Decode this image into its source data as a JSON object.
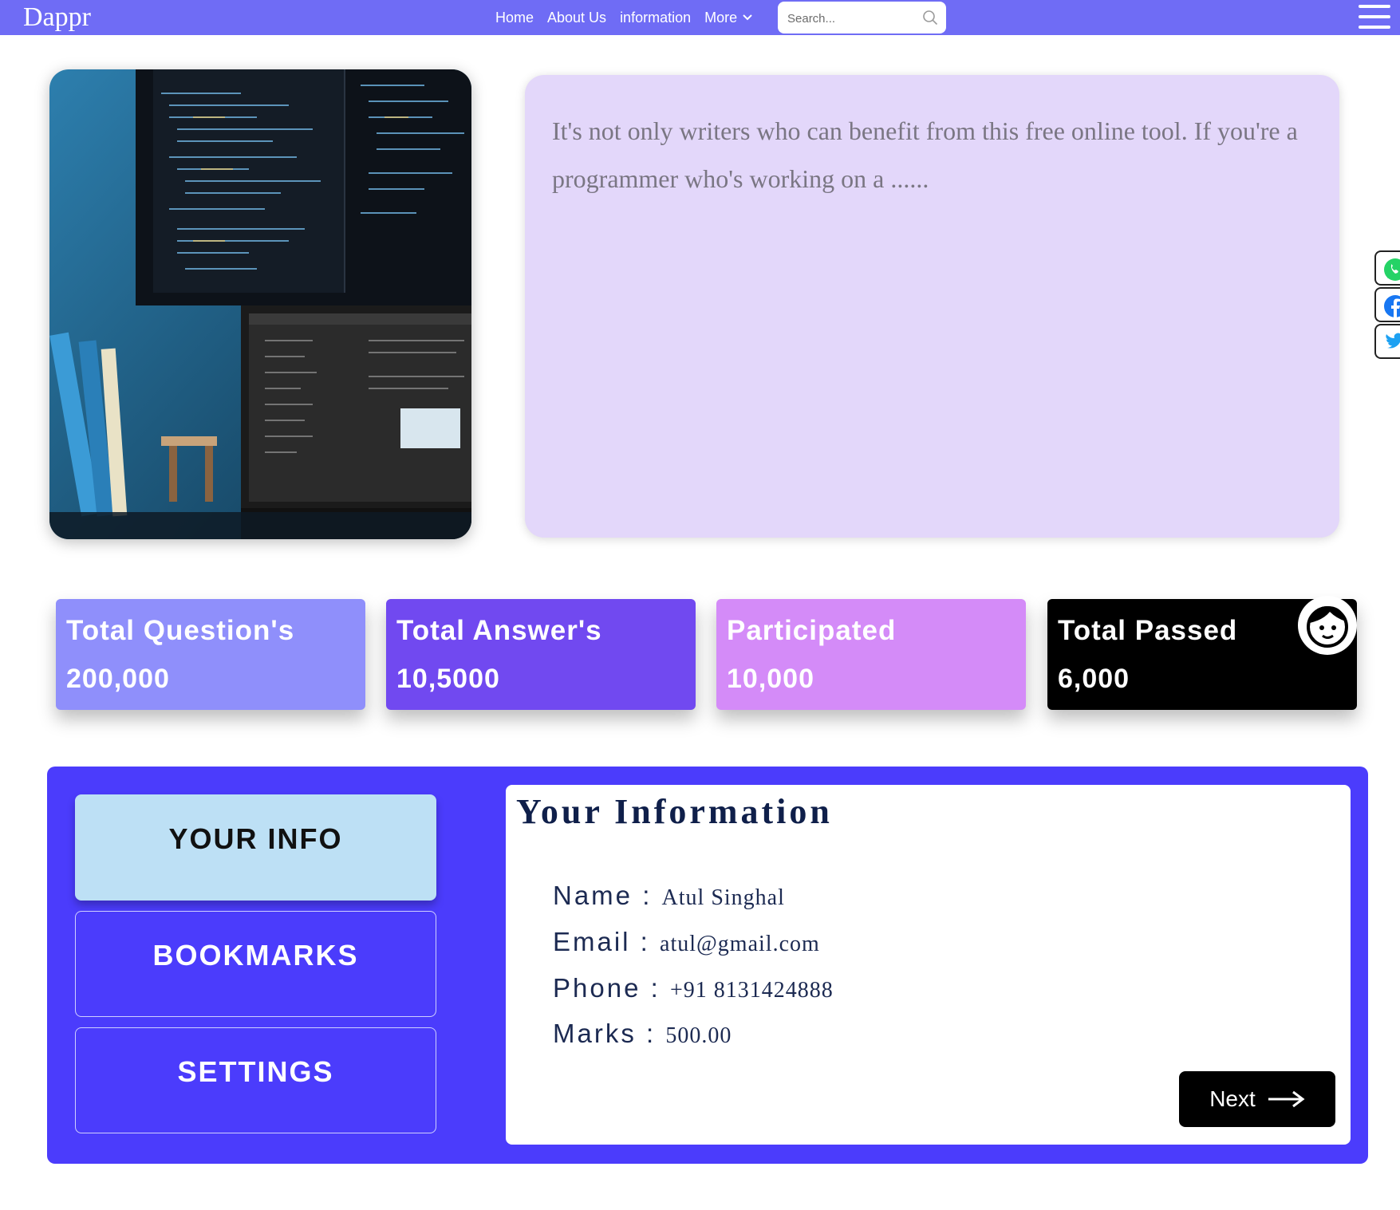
{
  "navbar": {
    "brand": "Dappr",
    "links": [
      "Home",
      "About Us",
      "information"
    ],
    "more_label": "More",
    "search_placeholder": "Search...",
    "bg_color": "#6f6cf5"
  },
  "hero": {
    "text": "It's not only writers who can benefit from this free online tool. If you're a programmer who's working on a ......",
    "text_bg": "#e3d7fa"
  },
  "stats": [
    {
      "label": "Total Question's",
      "value": "200,000",
      "color": "#8f8ffb"
    },
    {
      "label": "Total Answer's",
      "value": "10,5000",
      "color": "#7149f0"
    },
    {
      "label": "Participated",
      "value": "10,000",
      "color": "#d48bf8"
    },
    {
      "label": "Total Passed",
      "value": "6,000",
      "color": "#000000"
    }
  ],
  "sidebar_buttons": [
    "YOUR INFO",
    "BOOKMARKS",
    "SETTINGS"
  ],
  "info": {
    "title": "Your Information",
    "rows": [
      {
        "key": "Name : ",
        "value": "Atul Singhal"
      },
      {
        "key": "Email : ",
        "value": "atul@gmail.com"
      },
      {
        "key": "Phone : ",
        "value": "+91 8131424888"
      },
      {
        "key": "Marks : ",
        "value": "500.00"
      }
    ],
    "next_label": "Next"
  },
  "social": [
    "whatsapp-icon",
    "facebook-icon",
    "twitter-icon"
  ],
  "colors": {
    "panel": "#4b3cfc",
    "active_tab": "#bde0f5"
  }
}
